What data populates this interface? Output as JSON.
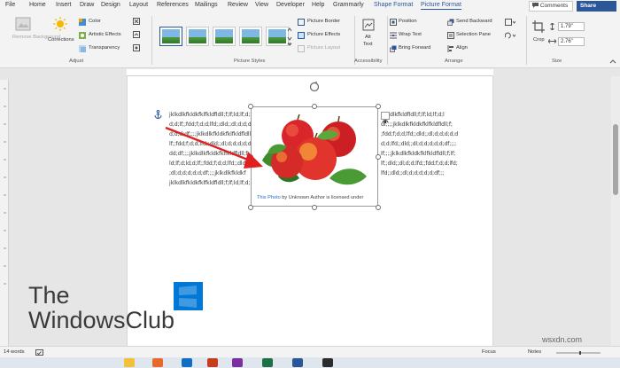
{
  "tabs": [
    {
      "label": "File"
    },
    {
      "label": "Home"
    },
    {
      "label": "Insert"
    },
    {
      "label": "Draw"
    },
    {
      "label": "Design"
    },
    {
      "label": "Layout"
    },
    {
      "label": "References"
    },
    {
      "label": "Mailings"
    },
    {
      "label": "Review"
    },
    {
      "label": "View"
    },
    {
      "label": "Developer"
    },
    {
      "label": "Help"
    },
    {
      "label": "Grammarly"
    },
    {
      "label": "Shape Format"
    },
    {
      "label": "Picture Format"
    }
  ],
  "header": {
    "comments": "Comments",
    "share": "Share"
  },
  "ribbon": {
    "remove_bg": "Remove Background",
    "corrections": "Corrections",
    "color": "Color",
    "artistic": "Artistic Effects",
    "transparency": "Transparency",
    "adjust": "Adjust",
    "picture_styles": "Picture Styles",
    "picture_border": "Picture Border",
    "picture_effects": "Picture Effects",
    "picture_layout": "Picture Layout",
    "alt_text_1": "Alt",
    "alt_text_2": "Text",
    "accessibility": "Accessibility",
    "position": "Position",
    "wrap_text": "Wrap Text",
    "bring_forward": "Bring Forward",
    "send_backward": "Send Backward",
    "selection_pane": "Selection Pane",
    "align": "Align",
    "arrange": "Arrange",
    "crop": "Crop",
    "height": "1.79\"",
    "width": "2.76\"",
    "size": "Size"
  },
  "document": {
    "lines": [
      "jklkdlkfkldkfklfkldfldll;f;lf;ld;lf;d;l",
      "d;d;lf;;fdd;f;d;d;lfd;;dld;;dl;d;d;d;",
      "d;d;d;df;;;;jklkdlkfkldkfklfkldfldll;",
      "lf;;fdd;f;d;d;lfd;;dld;;dl;d;d;d;d;d;",
      "dd;df;;;;jklkdlkfkldkfklfkldfldll;f;",
      "ld;lf;d;ld;d;lf;;fdd;f;d;d;lfd;;dld;;",
      ";dl;d;d;d;d;d;df;;;;jklkdlkfkldkf",
      "jklkdlkfkldkfklfkldfldll;f;lf;ld;lf;d;"
    ],
    "lines_right": [
      "jklkdlkfkldfldll;f;lf;ld;lf;d;l",
      "df;;;;jklkdlkfkldkfklfkldfldll;f;",
      ";fdd;f;d;d;lfd;;dld;;dl;d;d;d;d;d",
      "d;d;lfd;;dld;;dl;d;d;d;d;d;df;;;;",
      "lf;;;;jklkdlkfkldkfklfkldfldll;f;lf;",
      "lf;;dld;;dl;d;d;lfd;;fdd;f;d;d;lfd;",
      "lfd;;dld;;dl;d;d;d;d;d;df;;;",
      ""
    ],
    "caption_link": "This Photo",
    "caption_rest": " by Unknown Author is licensed under"
  },
  "status": {
    "words": "14 words",
    "focus": "Focus",
    "notes": "Notes"
  },
  "watermark": {
    "line1": "The",
    "line2": "WindowsClub",
    "site": "wsxdn.com"
  },
  "colors": {
    "accent": "#2b579a",
    "arrow": "#e02020",
    "logo_blue": "#0078d7"
  }
}
